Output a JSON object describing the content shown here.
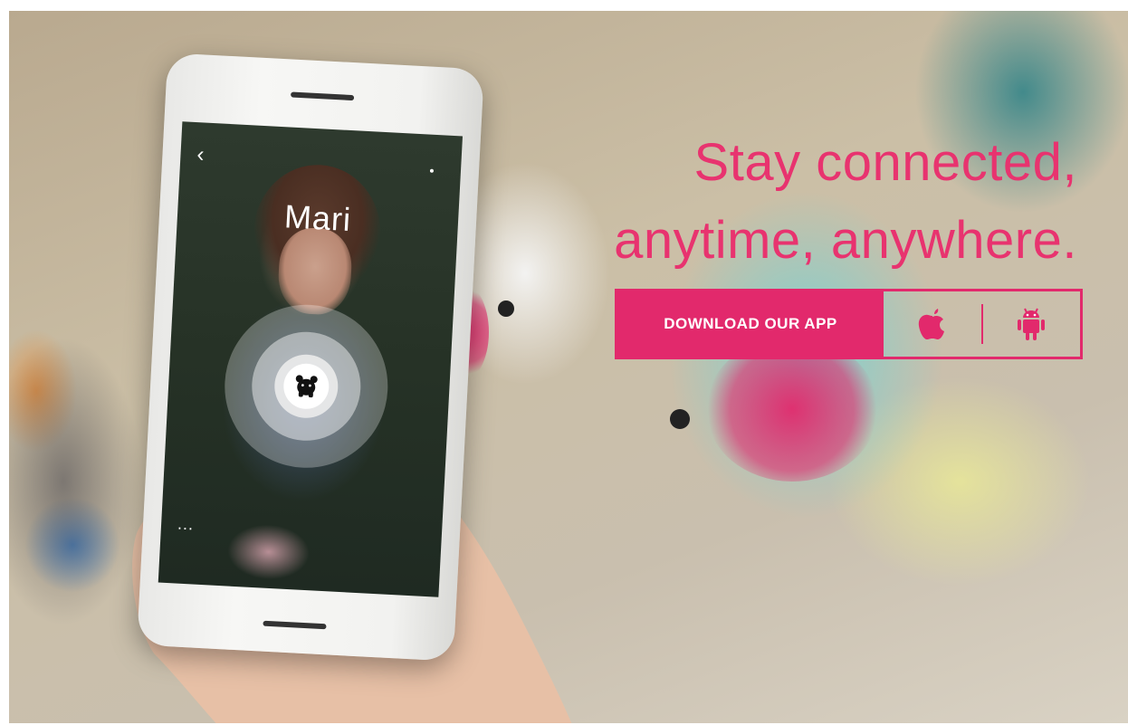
{
  "headline": {
    "line1": "Stay connected,",
    "line2": "anytime, anywhere."
  },
  "download": {
    "label": "DOWNLOAD OUR APP",
    "ios_icon": "apple-icon",
    "android_icon": "android-icon"
  },
  "phone_screen": {
    "contact_name": "Mari",
    "back_icon": "back-chevron-icon",
    "more_label": "...",
    "center_icon": "bear-icon"
  },
  "colors": {
    "accent": "#e2296c",
    "headline": "#e8336f"
  }
}
